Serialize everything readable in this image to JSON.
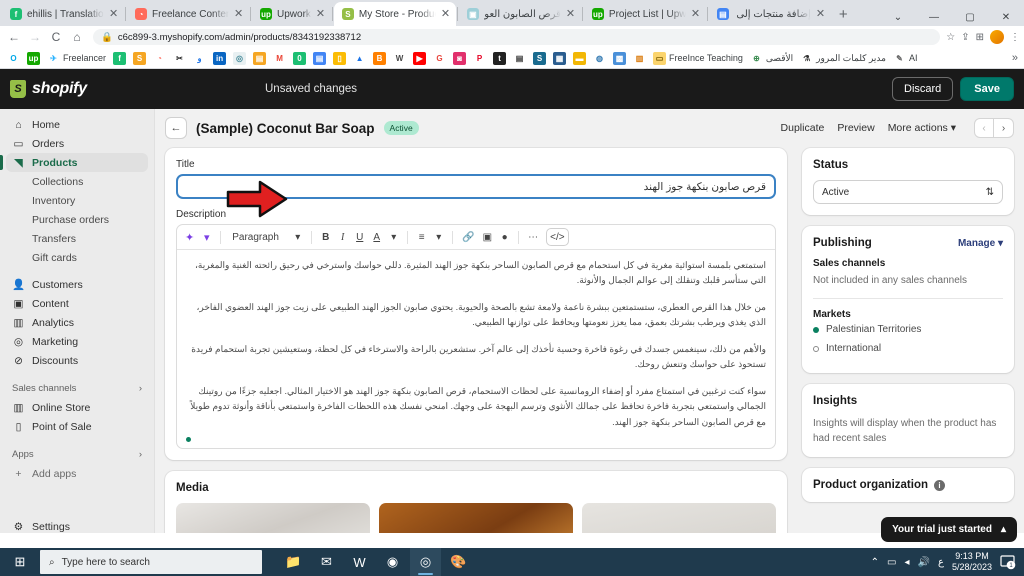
{
  "browser": {
    "tabs": [
      {
        "title": "ehillis | Translation, La",
        "favicon": "fiverr-icon",
        "color": "#1dbf73",
        "glyph": "f",
        "active": false,
        "rtl": false
      },
      {
        "title": "Freelance Content Wr",
        "favicon": "clock-icon",
        "color": "#ff6b5b",
        "glyph": "◔",
        "active": false,
        "rtl": false
      },
      {
        "title": "Upwork",
        "favicon": "upwork-icon",
        "color": "#14a800",
        "glyph": "up",
        "active": false,
        "rtl": false
      },
      {
        "title": "My Store - Products ·",
        "favicon": "shopify-icon",
        "color": "#95bf47",
        "glyph": "S",
        "active": true,
        "rtl": false
      },
      {
        "title": "قرص الصابون العوزي",
        "favicon": "google-docs-icon",
        "color": "#9ecfd8",
        "glyph": "▣",
        "active": false,
        "rtl": true
      },
      {
        "title": "Project List | Upwork",
        "favicon": "upwork-icon",
        "color": "#14a800",
        "glyph": "up",
        "active": false,
        "rtl": false
      },
      {
        "title": "إضافة منتجات إلى متج",
        "favicon": "docs-icon",
        "color": "#4285f4",
        "glyph": "▤",
        "active": false,
        "rtl": true
      }
    ],
    "new_tab_label": "+",
    "window_controls": {
      "list": "⌄",
      "minimize": "—",
      "maximize": "▢",
      "close": "✕"
    },
    "toolbar": {
      "back": "←",
      "forward": "→",
      "reload": "C",
      "home": "⌂",
      "lock_icon": "lock-icon",
      "url": "c6c899-3.myshopify.com/admin/products/8343192338712",
      "bookmark_star": "☆",
      "share": "⇪",
      "extensions": "⊞",
      "menu": "⋮"
    },
    "bookmarks": [
      {
        "label": "",
        "glyph": "O",
        "color": "#ffffff",
        "text_color": "#00a8e8",
        "name": "bookmark-o"
      },
      {
        "label": "",
        "glyph": "up",
        "color": "#14a800",
        "text_color": "#ffffff",
        "name": "bookmark-upwork"
      },
      {
        "label": "Freelancer",
        "glyph": "✈",
        "color": "#ffffff",
        "text_color": "#29b2fe",
        "name": "bookmark-freelancer"
      },
      {
        "label": "",
        "glyph": "f",
        "color": "#1dbf73",
        "text_color": "#ffffff",
        "name": "bookmark-fiverr"
      },
      {
        "label": "",
        "glyph": "S",
        "color": "#f5a623",
        "text_color": "#ffffff",
        "name": "bookmark-s"
      },
      {
        "label": "",
        "glyph": "◔",
        "color": "#ffffff",
        "text_color": "#ff6b5b",
        "name": "bookmark-clock"
      },
      {
        "label": "",
        "glyph": "✂",
        "color": "#ffffff",
        "text_color": "#222222",
        "name": "bookmark-tools"
      },
      {
        "label": "",
        "glyph": "و",
        "color": "#ffffff",
        "text_color": "#1a73e8",
        "name": "bookmark-arabic"
      },
      {
        "label": "",
        "glyph": "in",
        "color": "#0a66c2",
        "text_color": "#ffffff",
        "name": "bookmark-linkedin"
      },
      {
        "label": "",
        "glyph": "◎",
        "color": "#e8f0f2",
        "text_color": "#4a8d9c",
        "name": "bookmark-circle"
      },
      {
        "label": "",
        "glyph": "▤",
        "color": "#f5a623",
        "text_color": "#ffffff",
        "name": "bookmark-orange-doc"
      },
      {
        "label": "",
        "glyph": "M",
        "color": "#ffffff",
        "text_color": "#ea4335",
        "name": "bookmark-gmail"
      },
      {
        "label": "",
        "glyph": "0",
        "color": "#1dbf73",
        "text_color": "#ffffff",
        "name": "bookmark-green-zero"
      },
      {
        "label": "",
        "glyph": "▤",
        "color": "#4285f4",
        "text_color": "#ffffff",
        "name": "bookmark-blue-doc"
      },
      {
        "label": "",
        "glyph": "▯",
        "color": "#fbbc04",
        "text_color": "#ffffff",
        "name": "bookmark-keep"
      },
      {
        "label": "",
        "glyph": "▲",
        "color": "#ffffff",
        "text_color": "#1a73e8",
        "name": "bookmark-drive"
      },
      {
        "label": "",
        "glyph": "B",
        "color": "#ff8000",
        "text_color": "#ffffff",
        "name": "bookmark-blogger"
      },
      {
        "label": "",
        "glyph": "W",
        "color": "#ffffff",
        "text_color": "#464646",
        "name": "bookmark-wordpress"
      },
      {
        "label": "",
        "glyph": "▶",
        "color": "#ff0000",
        "text_color": "#ffffff",
        "name": "bookmark-youtube"
      },
      {
        "label": "",
        "glyph": "G",
        "color": "#ffffff",
        "text_color": "#e8453c",
        "name": "bookmark-g"
      },
      {
        "label": "",
        "glyph": "◙",
        "color": "#e1306c",
        "text_color": "#ffffff",
        "name": "bookmark-instagram"
      },
      {
        "label": "",
        "glyph": "P",
        "color": "#ffffff",
        "text_color": "#e60023",
        "name": "bookmark-pinterest"
      },
      {
        "label": "",
        "glyph": "t",
        "color": "#222222",
        "text_color": "#ffffff",
        "name": "bookmark-t"
      },
      {
        "label": "",
        "glyph": "▤",
        "color": "#ffffff",
        "text_color": "#333333",
        "name": "bookmark-bench"
      },
      {
        "label": "",
        "glyph": "S",
        "color": "#1a6b8f",
        "text_color": "#ffffff",
        "name": "bookmark-s2"
      },
      {
        "label": "",
        "glyph": "▦",
        "color": "#2a5d8f",
        "text_color": "#ffffff",
        "name": "bookmark-paypal"
      },
      {
        "label": "",
        "glyph": "▬",
        "color": "#f2b705",
        "text_color": "#ffffff",
        "name": "bookmark-yellow"
      },
      {
        "label": "",
        "glyph": "◍",
        "color": "#ffffff",
        "text_color": "#3b7fb5",
        "name": "bookmark-circle2"
      },
      {
        "label": "",
        "glyph": "▩",
        "color": "#4a90d9",
        "text_color": "#ffffff",
        "name": "bookmark-blue2"
      },
      {
        "label": "",
        "glyph": "▥",
        "color": "#ffffff",
        "text_color": "#d97706",
        "name": "bookmark-trello"
      },
      {
        "label": "FreeInce Teaching",
        "glyph": "▭",
        "color": "#fbd46d",
        "text_color": "#7a5c00",
        "name": "bookmark-folder-freeince"
      },
      {
        "label": "الأقصى",
        "glyph": "⊕",
        "color": "#ffffff",
        "text_color": "#3c8d52",
        "name": "bookmark-alaqsa"
      },
      {
        "label": "مدير كلمات المرور",
        "glyph": "⚗",
        "color": "#ffffff",
        "text_color": "#333333",
        "name": "bookmark-password-manager"
      },
      {
        "label": "AI",
        "glyph": "✎",
        "color": "#ffffff",
        "text_color": "#666666",
        "name": "bookmark-ai"
      }
    ],
    "bookmarks_overflow": "»"
  },
  "shopify": {
    "brand": "shopify",
    "brand_glyph": "S",
    "unsaved_label": "Unsaved changes",
    "discard_label": "Discard",
    "save_label": "Save",
    "accent_green": "#00796b",
    "sidebar": {
      "items": [
        {
          "label": "Home",
          "icon": "home-icon",
          "glyph": "⌂",
          "active": false
        },
        {
          "label": "Orders",
          "icon": "orders-icon",
          "glyph": "▭",
          "active": false
        },
        {
          "label": "Products",
          "icon": "products-tag-icon",
          "glyph": "◥",
          "active": true
        }
      ],
      "sub_items": [
        "Collections",
        "Inventory",
        "Purchase orders",
        "Transfers",
        "Gift cards"
      ],
      "items2": [
        {
          "label": "Customers",
          "icon": "customers-icon",
          "glyph": "👤"
        },
        {
          "label": "Content",
          "icon": "content-icon",
          "glyph": "▣"
        },
        {
          "label": "Analytics",
          "icon": "analytics-icon",
          "glyph": "▥"
        },
        {
          "label": "Marketing",
          "icon": "marketing-icon",
          "glyph": "◎"
        },
        {
          "label": "Discounts",
          "icon": "discounts-icon",
          "glyph": "⊘"
        }
      ],
      "group_sales_channels": "Sales channels",
      "sales_channels": [
        {
          "label": "Online Store",
          "icon": "store-icon",
          "glyph": "▥"
        },
        {
          "label": "Point of Sale",
          "icon": "pos-icon",
          "glyph": "▯"
        }
      ],
      "group_apps": "Apps",
      "add_apps": "Add apps",
      "add_apps_glyph": "+",
      "settings": "Settings",
      "settings_glyph": "⚙",
      "chevron": "›"
    },
    "page": {
      "back_glyph": "←",
      "title": "(Sample) Coconut Bar Soap",
      "status_badge": "Active",
      "actions": [
        "Duplicate",
        "Preview"
      ],
      "more_actions": "More actions",
      "more_caret": "▾",
      "pager_prev": "‹",
      "pager_next": "›"
    },
    "title_field": {
      "label": "Title",
      "value": "قرص صابون بنكهة جوز الهند"
    },
    "description": {
      "label": "Description",
      "toolbar": {
        "magic_glyph": "✦",
        "magic_caret": "▾",
        "paragraph_label": "Paragraph",
        "paragraph_caret": "▾",
        "bold": "B",
        "italic": "I",
        "underline": "U",
        "text_color": "A",
        "text_color_caret": "▾",
        "align": "≡",
        "align_caret": "▾",
        "link": "🔗",
        "image": "▣",
        "video": "●",
        "more": "⋯",
        "code": "</>"
      },
      "paragraphs": [
        "استمتعي بلمسة استوائية مغرية في كل استحمام مع قرص الصابون الساحر بنكهة جوز الهند المثيرة. دللي حواسك واسترخي في رحيق رائحته الغنية والمغرية، التي ستأسر قلبك وتنقلك إلى عوالم الجمال والأنوثة.",
        "من خلال هذا القرص العطري، ستستمتعين ببشرة ناعمة ولامعة تشع بالصحة والحيوية. يحتوي صابون الجوز الهند الطبيعي على زيت جوز الهند العضوي الفاخر، الذي يغذي ويرطب بشرتك بعمق، مما يعزز نعومتها ويحافظ على توازنها الطبيعي.",
        "والأهم من ذلك، سينغمس جسدك في رغوة فاخرة وحسية تأخذك إلى عالم آخر. ستشعرين بالراحة والاسترخاء في كل لحظة، وستعيشين تجربة استحمام فريدة تستحوذ على حواسك وتنعش روحك.",
        "سواء كنت ترغبين في استمتاع مفرد أو إضفاء الرومانسية على لحظات الاستحمام، قرص الصابون بنكهة جوز الهند هو الاختيار المثالي. اجعليه جزءًا من روتينك الجمالي واستمتعي بتجربة فاخرة تحافظ على جمالك الأنثوي وترسم البهجة على وجهك. امنحي نفسك هذه اللحظات الفاخرة واستمتعي بأناقة وأنوثة تدوم طويلاً مع قرص الصابون الساحر بنكهة جوز الهند."
      ]
    },
    "media": {
      "title": "Media"
    },
    "status_card": {
      "title": "Status",
      "value": "Active",
      "caret": "⇅"
    },
    "publishing_card": {
      "title": "Publishing",
      "manage_label": "Manage",
      "manage_caret": "▾",
      "sales_channels_label": "Sales channels",
      "sales_channels_value": "Not included in any sales channels",
      "markets_label": "Markets",
      "markets": [
        {
          "label": "Palestinian Territories",
          "included": true
        },
        {
          "label": "International",
          "included": false
        }
      ]
    },
    "insights_card": {
      "title": "Insights",
      "text": "Insights will display when the product has had recent sales"
    },
    "product_organization": {
      "title": "Product organization",
      "info_glyph": "i"
    },
    "toast": {
      "text": "Your trial just started",
      "caret": "▴"
    },
    "annotation": {
      "arrow_name": "red-arrow-pointer",
      "arrow_color": "#e02020"
    }
  },
  "taskbar": {
    "start_glyph": "⊞",
    "search_placeholder": "Type here to search",
    "search_glyph": "⌕",
    "icons": [
      {
        "name": "file-explorer-icon",
        "glyph": "📁",
        "running": false
      },
      {
        "name": "mail-icon",
        "glyph": "✉",
        "running": false
      },
      {
        "name": "word-icon",
        "glyph": "W",
        "running": false
      },
      {
        "name": "edge-icon",
        "glyph": "◉",
        "running": false
      },
      {
        "name": "chrome-icon",
        "glyph": "◎",
        "running": true
      },
      {
        "name": "paint-icon",
        "glyph": "🎨",
        "running": false
      }
    ],
    "tray": {
      "chevron": "⌃",
      "battery": "▭",
      "wifi": "◂",
      "volume": "🔊",
      "language": "ع",
      "time": "9:13 PM",
      "date": "5/28/2023",
      "notifications_count": "1"
    }
  }
}
